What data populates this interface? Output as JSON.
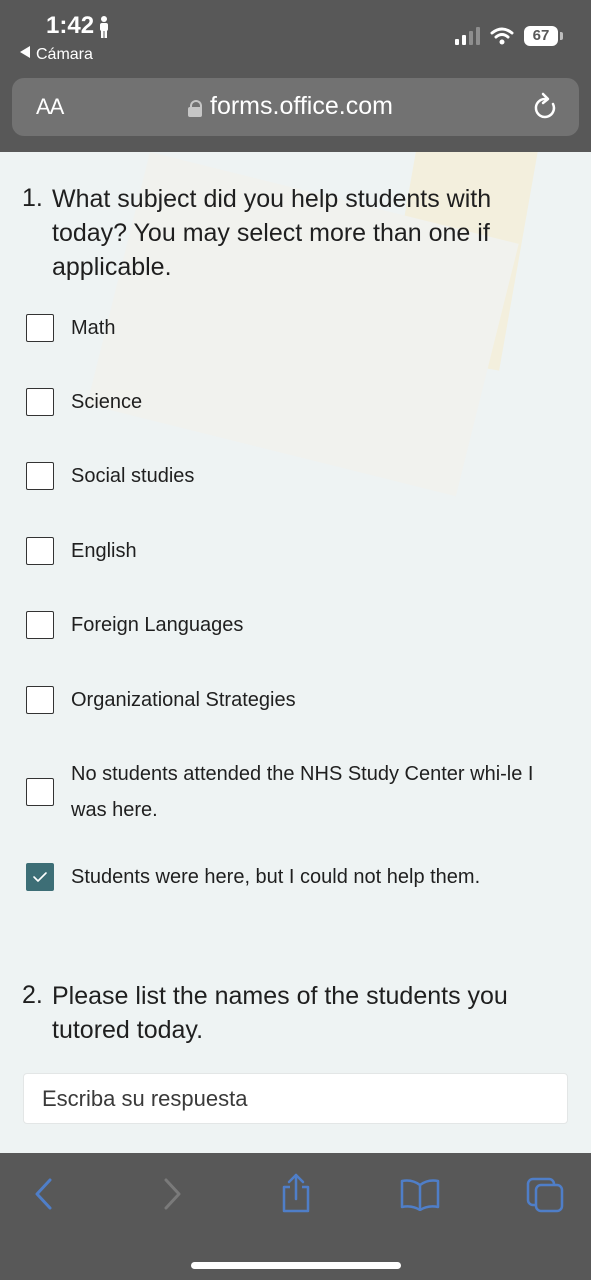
{
  "status": {
    "time": "1:42",
    "back_app": "Cámara",
    "battery": "67"
  },
  "browser": {
    "aa": "AA",
    "url": "forms.office.com"
  },
  "form": {
    "q1": {
      "number": "1.",
      "text": "What subject did you help students with today? You may select more than one if applicable.",
      "options": [
        {
          "label": "Math",
          "checked": false
        },
        {
          "label": "Science",
          "checked": false
        },
        {
          "label": "Social studies",
          "checked": false
        },
        {
          "label": "English",
          "checked": false
        },
        {
          "label": "Foreign Languages",
          "checked": false
        },
        {
          "label": "Organizational Strategies",
          "checked": false
        },
        {
          "label": "No students attended the NHS Study Center whi-le I was here.",
          "checked": false
        },
        {
          "label": "Students were here, but I could not help them.",
          "checked": true
        }
      ]
    },
    "q2": {
      "number": "2.",
      "text": "Please list the names of the students you tutored today.",
      "placeholder": "Escriba su respuesta"
    }
  },
  "colors": {
    "chrome": "#585858",
    "checkbox_checked": "#3d6e76",
    "toolbar_icon_active": "#4f7ec8",
    "toolbar_icon_disabled": "#7a7a7a"
  },
  "toolbar": {
    "icons": [
      "back-icon",
      "forward-icon",
      "share-icon",
      "bookmarks-icon",
      "tabs-icon"
    ]
  }
}
